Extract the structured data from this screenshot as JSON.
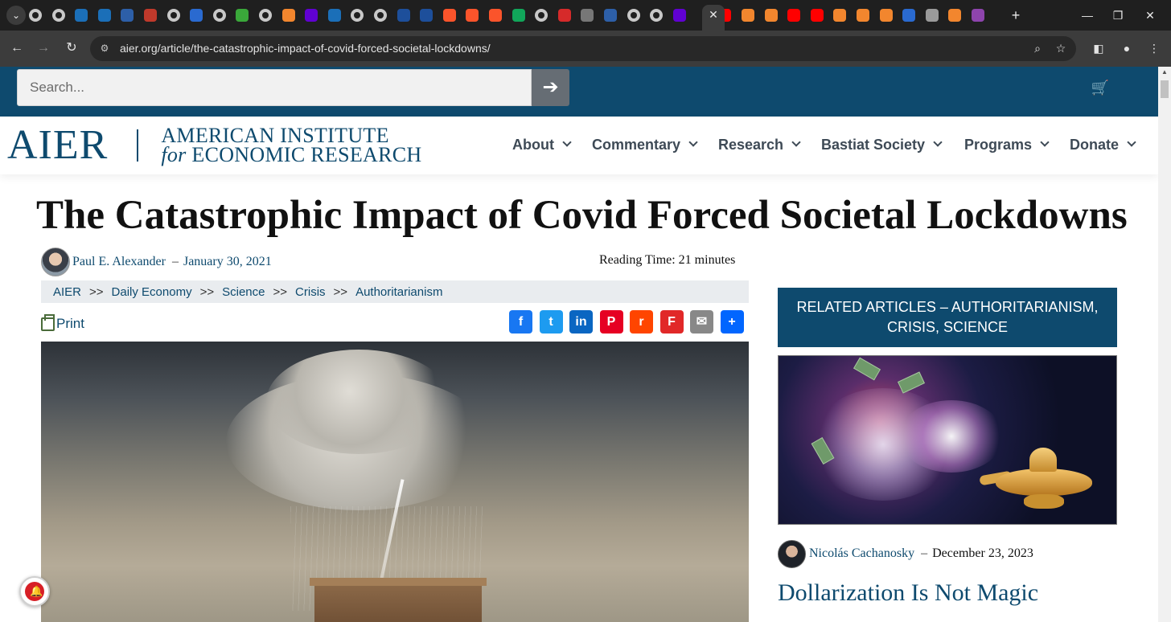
{
  "browser": {
    "url": "aier.org/article/the-catastrophic-impact-of-covid-forced-societal-lockdowns/",
    "tab_icons": [
      "globe",
      "globe",
      "shield",
      "shield",
      "arrow",
      "bi",
      "globe",
      "search",
      "globe",
      "play",
      "globe",
      "bookmark",
      "yahoo",
      "shield",
      "globe",
      "globe",
      "cube",
      "cube",
      "brave",
      "brave",
      "brave",
      "g",
      "globe",
      "podcast",
      "slash",
      "arrow",
      "globe",
      "globe",
      "yahoo",
      "active",
      "youtube",
      "bookmark",
      "bookmark",
      "youtube",
      "youtube",
      "bookmark",
      "bookmark",
      "bookmark",
      "search",
      "image",
      "bookmark",
      "purple"
    ]
  },
  "site": {
    "search_placeholder": "Search...",
    "logo_mark": "AIER",
    "logo_line1": "AMERICAN INSTITUTE",
    "logo_line2_italic": "for",
    "logo_line2_rest": "ECONOMIC RESEARCH",
    "nav": [
      "About",
      "Commentary",
      "Research",
      "Bastiat Society",
      "Programs",
      "Donate"
    ]
  },
  "article": {
    "title": "The Catastrophic Impact of Covid Forced Societal Lockdowns",
    "author": "Paul E. Alexander",
    "date": "January 30, 2021",
    "reading_time": "Reading Time: 21 minutes",
    "breadcrumbs": [
      "AIER",
      "Daily Economy",
      "Science",
      "Crisis",
      "Authoritarianism"
    ],
    "breadcrumb_sep": ">>",
    "print_label": "Print",
    "share": [
      {
        "name": "facebook",
        "glyph": "f",
        "color": "#1877f2"
      },
      {
        "name": "twitter",
        "glyph": "t",
        "color": "#1d9bf0"
      },
      {
        "name": "linkedin",
        "glyph": "in",
        "color": "#0a66c2"
      },
      {
        "name": "pinterest",
        "glyph": "P",
        "color": "#e60023"
      },
      {
        "name": "reddit",
        "glyph": "r",
        "color": "#ff4500"
      },
      {
        "name": "flipboard",
        "glyph": "F",
        "color": "#e12828"
      },
      {
        "name": "email",
        "glyph": "✉",
        "color": "#888888"
      },
      {
        "name": "share",
        "glyph": "+",
        "color": "#0166ff"
      }
    ]
  },
  "sidebar": {
    "heading": "RELATED ARTICLES – AUTHORITARIANISM, CRISIS, SCIENCE",
    "author": "Nicolás Cachanosky",
    "date": "December 23, 2023",
    "title": "Dollarization Is Not Magic"
  },
  "colors": {
    "brand_navy": "#0e4a6e",
    "search_button": "#666d74",
    "breadcrumb_bg": "#e9ecef"
  }
}
